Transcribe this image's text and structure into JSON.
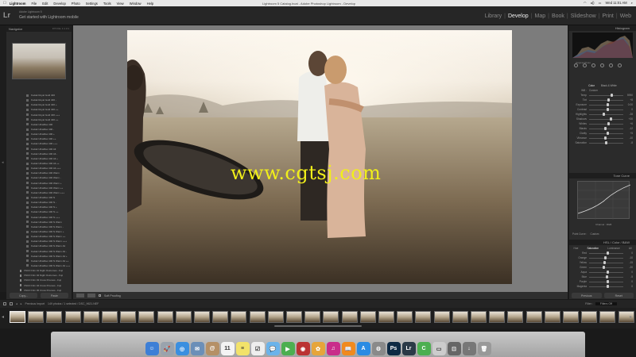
{
  "menubar": {
    "items": [
      "Lightroom",
      "File",
      "Edit",
      "Develop",
      "Photo",
      "Settings",
      "Tools",
      "View",
      "Window",
      "Help"
    ],
    "window_title": "Lightroom 5 Catalog.lrcat - Adobe Photoshop Lightroom - Develop",
    "clock": "Wed 11:01 AM"
  },
  "identity": {
    "logo": "Lr",
    "plate_label": "Adobe Lightroom 5",
    "get_started": "Get started with Lightroom mobile"
  },
  "modules": [
    "Library",
    "Develop",
    "Map",
    "Book",
    "Slideshow",
    "Print",
    "Web"
  ],
  "active_module": "Develop",
  "left_panel": {
    "navigator_title": "Navigator",
    "navigator_options": "FIT  FILL  1:1  3:1",
    "presets": [
      "Kodak Royal Gold 400",
      "Kodak Royal Gold 400 -",
      "Kodak Royal Gold 400 +",
      "Kodak Royal Gold 400 ++",
      "Kodak Royal Gold 400 +++",
      "Kodak Royal Gold 400 ++",
      "Kodak UltraMax 400",
      "Kodak UltraMax 400 -",
      "Kodak UltraMax 400 +",
      "Kodak UltraMax 400 ++",
      "Kodak UltraMax 400 +++",
      "Kodak UltraMax 400 Alt",
      "Kodak UltraMax 400 Alt -",
      "Kodak UltraMax 400 Alt +",
      "Kodak UltraMax 400 Alt ++",
      "Kodak UltraMax 400 Alt +++",
      "Kodak UltraMax 400 Warm",
      "Kodak UltraMax 400 Warm -",
      "Kodak UltraMax 400 Warm +",
      "Kodak UltraMax 400 Warm ++",
      "Kodak UltraMax 400 Warm +++",
      "Kodak UltraMax 400 N",
      "Kodak UltraMax 400 N -",
      "Kodak UltraMax 400 N +",
      "Kodak UltraMax 400 N ++",
      "Kodak UltraMax 400 N +++",
      "Kodak UltraMax 400 N Warm",
      "Kodak UltraMax 400 N Warm -",
      "Kodak UltraMax 400 N Warm +",
      "Kodak UltraMax 400 N Warm ++",
      "Kodak UltraMax 400 N Warm +++",
      "Kodak UltraMax 400 N Warm Alt",
      "Kodak UltraMax 400 N Warm Alt -",
      "Kodak UltraMax 400 N Warm Alt +",
      "Kodak UltraMax 400 N Warm Alt ++",
      "Kodak UltraMax 400 N Warm Alt +++"
    ],
    "groups": [
      "VSCO Film 01 Night Outcomes - Fuji",
      "VSCO Film 02 Night Outcomes - Fuji",
      "VSCO Film 03 Cross Process - Fuji",
      "VSCO Film 04 Cross Process - Fuji",
      "VSCO Film 05 Cross Process - Fuji",
      "VSCO Film 06 Cross Process - Fuji"
    ],
    "copy_label": "Copy...",
    "paste_label": "Paste"
  },
  "toolbar": {
    "soft_proofing": "Soft Proofing"
  },
  "watermark": "www.cgtsj.com",
  "right_panel": {
    "histogram_title": "Histogram",
    "original_photo": "Original Photo",
    "basic": {
      "treatment_color": "Color",
      "treatment_bw": "Black & White",
      "wb_label": "WB :",
      "wb_value": "Custom",
      "temp_label": "Temp",
      "tint_label": "Tint",
      "tone_label": "Tone",
      "auto_label": "Auto",
      "presence_label": "Presence",
      "sliders": [
        {
          "label": "Temp",
          "value": "5950",
          "pos": 0.62
        },
        {
          "label": "Tint",
          "value": "+8",
          "pos": 0.54
        },
        {
          "label": "Exposure",
          "value": "0.00",
          "pos": 0.5
        },
        {
          "label": "Contrast",
          "value": "0",
          "pos": 0.5
        },
        {
          "label": "Highlights",
          "value": "-28",
          "pos": 0.4
        },
        {
          "label": "Shadows",
          "value": "+20",
          "pos": 0.6
        },
        {
          "label": "Whites",
          "value": "+6",
          "pos": 0.53
        },
        {
          "label": "Blacks",
          "value": "-12",
          "pos": 0.44
        },
        {
          "label": "Clarity",
          "value": "+5",
          "pos": 0.52
        },
        {
          "label": "Vibrance",
          "value": "-10",
          "pos": 0.45
        },
        {
          "label": "Saturation",
          "value": "-8",
          "pos": 0.46
        }
      ]
    },
    "tone_curve_title": "Tone Curve",
    "channel_label": "Channel :",
    "channel_value": "RGB",
    "point_curve_label": "Point Curve :",
    "point_curve_value": "Custom",
    "hsl_label": "HSL / Color / B&W",
    "hsl_tabs": [
      "Hue",
      "Saturation",
      "Luminance",
      "All"
    ],
    "hsl_active": "Saturation",
    "hsl_rows": [
      {
        "label": "Red",
        "value": "0",
        "pos": 0.5
      },
      {
        "label": "Orange",
        "value": "-10",
        "pos": 0.45
      },
      {
        "label": "Yellow",
        "value": "-15",
        "pos": 0.42
      },
      {
        "label": "Green",
        "value": "-20",
        "pos": 0.4
      },
      {
        "label": "Aqua",
        "value": "0",
        "pos": 0.5
      },
      {
        "label": "Blue",
        "value": "-5",
        "pos": 0.48
      },
      {
        "label": "Purple",
        "value": "0",
        "pos": 0.5
      },
      {
        "label": "Magenta",
        "value": "0",
        "pos": 0.5
      }
    ],
    "previous_label": "Previous",
    "reset_label": "Reset"
  },
  "filmstrip_bar": {
    "source": "Previous Import",
    "count": "149 photos / 1 selected / DSC_9621.NEF",
    "filter_label": "Filter :",
    "filter_value": "Filters Off"
  },
  "colors": {
    "watermark": "#f1ef1a",
    "panel_bg": "#2b2b2b",
    "center_bg": "#7c7c7c",
    "active_module": "#eeeeee"
  },
  "dock": [
    {
      "name": "finder",
      "glyph": "☺",
      "color": "#3d7fd6"
    },
    {
      "name": "launchpad",
      "glyph": "🚀",
      "color": "#9aa3ad"
    },
    {
      "name": "safari",
      "glyph": "◎",
      "color": "#3a8fe0"
    },
    {
      "name": "mail",
      "glyph": "✉",
      "color": "#6b8fb8"
    },
    {
      "name": "contacts",
      "glyph": "@",
      "color": "#b59066"
    },
    {
      "name": "calendar",
      "glyph": "11",
      "color": "#f4f4f4"
    },
    {
      "name": "notes",
      "glyph": "≡",
      "color": "#f2e26a"
    },
    {
      "name": "reminders",
      "glyph": "☑",
      "color": "#eeeeee"
    },
    {
      "name": "messages",
      "glyph": "💬",
      "color": "#6bb3ea"
    },
    {
      "name": "facetime",
      "glyph": "▶",
      "color": "#4caf50"
    },
    {
      "name": "photo-booth",
      "glyph": "◉",
      "color": "#b33"
    },
    {
      "name": "photos",
      "glyph": "✿",
      "color": "#e6a53a"
    },
    {
      "name": "itunes",
      "glyph": "♫",
      "color": "#c92d8a"
    },
    {
      "name": "ibooks",
      "glyph": "📖",
      "color": "#f08a1e"
    },
    {
      "name": "app-store",
      "glyph": "A",
      "color": "#2a8be3"
    },
    {
      "name": "system-prefs",
      "glyph": "⚙",
      "color": "#8a8a8a"
    },
    {
      "name": "photoshop",
      "glyph": "Ps",
      "color": "#0e2a44"
    },
    {
      "name": "lightroom",
      "glyph": "Lr",
      "color": "#2b3a47"
    },
    {
      "name": "camtasia",
      "glyph": "C",
      "color": "#4caf50"
    },
    {
      "name": "preview",
      "glyph": "▭",
      "color": "#cccccc"
    },
    {
      "name": "screenshot",
      "glyph": "⊡",
      "color": "#666666"
    },
    {
      "name": "downloads",
      "glyph": "↓",
      "color": "#777777"
    },
    {
      "name": "trash",
      "glyph": "🗑",
      "color": "#999999"
    }
  ]
}
